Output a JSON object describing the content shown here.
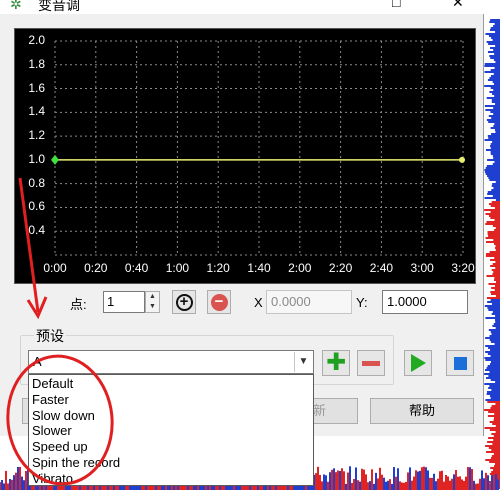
{
  "window": {
    "title": "变音调",
    "maximize_glyph": "□",
    "close_glyph": "✕"
  },
  "graph": {
    "y_ticks": [
      "2.0",
      "1.8",
      "1.6",
      "1.4",
      "1.2",
      "1.0",
      "0.8",
      "0.6",
      "0.4"
    ],
    "x_ticks": [
      "0:00",
      "0:20",
      "0:40",
      "1:00",
      "1:20",
      "1:40",
      "2:00",
      "2:20",
      "2:40",
      "3:00",
      "3:20"
    ],
    "curve_value": 1.0,
    "colors": {
      "background": "#000000",
      "grid": "#8a8a8a",
      "curve": "#e8f070",
      "point": "#40e040"
    }
  },
  "controls": {
    "point_label": "点:",
    "point_value": "1",
    "x_label": "X",
    "x_value": "0.0000",
    "y_label": "Y:",
    "y_value": "1.0000"
  },
  "preset": {
    "group_label": "预设",
    "selected": "A",
    "options": [
      "Default",
      "Faster",
      "Slow down",
      "Slower",
      "Speed up",
      "Spin the record",
      "Vibrato"
    ]
  },
  "buttons": {
    "apply_partial": "新",
    "help": "帮助"
  }
}
